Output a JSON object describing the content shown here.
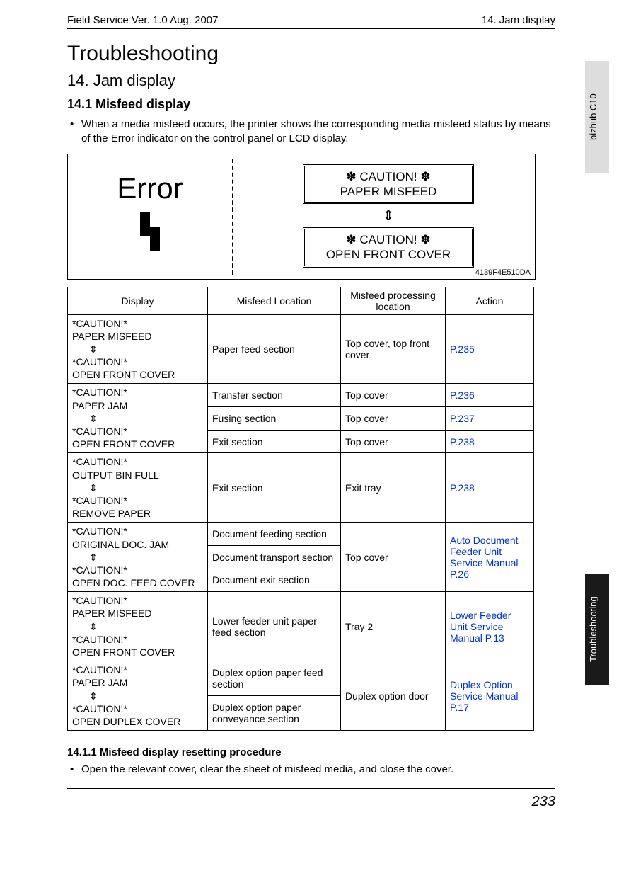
{
  "header": {
    "left": "Field Service Ver. 1.0 Aug. 2007",
    "right": "14. Jam display"
  },
  "titles": {
    "section": "Troubleshooting",
    "chapter": "14.  Jam display",
    "subsection": "14.1   Misfeed display",
    "subsub": "14.1.1      Misfeed display resetting procedure"
  },
  "intro_bullet": "When a media misfeed occurs, the printer shows the corresponding media misfeed status by means of the Error indicator on the control panel or LCD display.",
  "diagram": {
    "error_label": "Error",
    "lcd1_line1": "✽ CAUTION! ✽",
    "lcd1_line2": "PAPER MISFEED",
    "lcd2_line1": "✽ CAUTION! ✽",
    "lcd2_line2": "OPEN FRONT COVER",
    "arrow": "⇕",
    "id": "4139F4E510DA"
  },
  "table": {
    "headers": [
      "Display",
      "Misfeed Location",
      "Misfeed processing location",
      "Action"
    ],
    "rows": [
      {
        "display": [
          "*CAUTION!*",
          "PAPER MISFEED",
          "⇕",
          "*CAUTION!*",
          "OPEN FRONT COVER"
        ],
        "subs": [
          {
            "loc": "Paper feed section",
            "proc": "Top cover, top front cover",
            "action": "P.235"
          }
        ]
      },
      {
        "display": [
          "*CAUTION!*",
          "PAPER JAM",
          "⇕",
          "*CAUTION!*",
          "OPEN FRONT COVER"
        ],
        "subs": [
          {
            "loc": "Transfer section",
            "proc": "Top cover",
            "action": "P.236"
          },
          {
            "loc": "Fusing section",
            "proc": "Top cover",
            "action": "P.237"
          },
          {
            "loc": "Exit section",
            "proc": "Top cover",
            "action": "P.238"
          }
        ]
      },
      {
        "display": [
          "*CAUTION!*",
          "OUTPUT BIN FULL",
          "⇕",
          "*CAUTION!*",
          "REMOVE PAPER"
        ],
        "subs": [
          {
            "loc": "Exit section",
            "proc": "Exit tray",
            "action": "P.238"
          }
        ]
      },
      {
        "display": [
          "*CAUTION!*",
          "ORIGINAL DOC. JAM",
          "⇕",
          "*CAUTION!*",
          "OPEN DOC. FEED COVER"
        ],
        "proc_span": "Top cover",
        "action_span": "Auto Document Feeder Unit Service Manual P.26",
        "subs": [
          {
            "loc": "Document feeding section"
          },
          {
            "loc": "Document transport section"
          },
          {
            "loc": "Document exit section"
          }
        ]
      },
      {
        "display": [
          "*CAUTION!*",
          "PAPER MISFEED",
          "⇕",
          "*CAUTION!*",
          "OPEN FRONT COVER"
        ],
        "subs": [
          {
            "loc": "Lower feeder unit paper feed section",
            "proc": "Tray 2",
            "action": "Lower Feeder Unit Service Manual P.13"
          }
        ]
      },
      {
        "display": [
          "*CAUTION!*",
          "PAPER JAM",
          "⇕",
          "*CAUTION!*",
          "OPEN DUPLEX COVER"
        ],
        "proc_span": "Duplex option door",
        "action_span": "Duplex Option Service Manual P.17",
        "subs": [
          {
            "loc": "Duplex option paper feed section"
          },
          {
            "loc": "Duplex option paper conveyance section"
          }
        ]
      }
    ]
  },
  "reset_bullet": "Open the relevant cover, clear the sheet of misfeed media, and close the cover.",
  "page_number": "233",
  "tabs": {
    "top": "bizhub C10",
    "bottom": "Troubleshooting"
  }
}
